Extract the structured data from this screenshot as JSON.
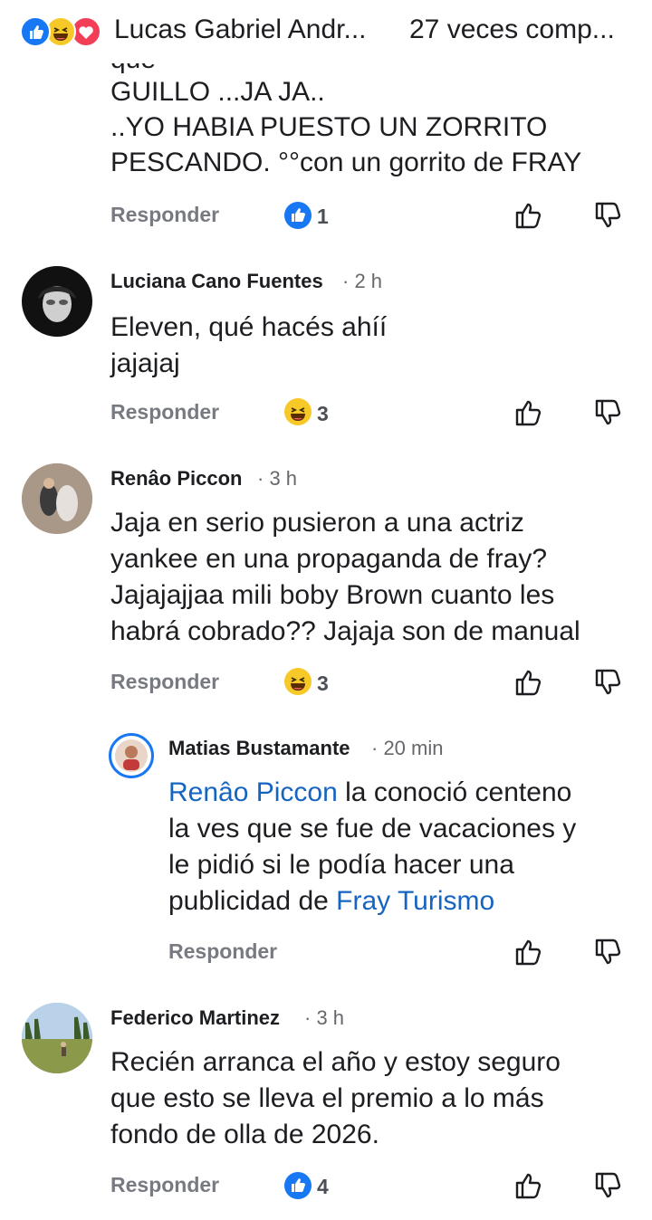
{
  "header": {
    "commenter_name": "Lucas Gabriel Andr...",
    "shares": "27 veces comp..."
  },
  "first_comment": {
    "partial_line": "que",
    "lines": [
      "GUILLO ...JA JA..",
      "..YO HABIA PUESTO UN ZORRITO",
      "PESCANDO. °°con  un gorrito de FRAY"
    ],
    "reply_label": "Responder",
    "reaction": "like-icon",
    "reaction_count": "1"
  },
  "comments": [
    {
      "author": "Luciana Cano Fuentes",
      "time": "· 2 h",
      "lines": [
        "Eleven, qué hacés ahíí",
        "jajajaj"
      ],
      "reply_label": "Responder",
      "reaction": "haha-emoji-icon",
      "reaction_count": "3"
    },
    {
      "author": "Renâo Piccon",
      "time": "· 3 h",
      "lines": [
        "Jaja en serio pusieron a una actriz",
        "yankee en una propaganda de fray?",
        "Jajajajjaa mili boby Brown cuanto les",
        "habrá cobrado?? Jajaja son de manual"
      ],
      "reply_label": "Responder",
      "reaction": "haha-emoji-icon",
      "reaction_count": "3"
    },
    {
      "author": "Matias Bustamante",
      "time": "· 20 min",
      "mention": "Renâo Piccon",
      "line1_rest": " la conoció centeno",
      "line2": "la ves que se fue de vacaciones y",
      "line3": "le pidió si le podía hacer una",
      "line4_start": "publicidad de ",
      "mention2": "Fray Turismo",
      "reply_label": "Responder"
    },
    {
      "author": "Federico Martinez",
      "time": "· 3 h",
      "lines": [
        "Recién arranca el año y estoy seguro",
        "que esto se lleva el premio a lo más",
        "fondo de olla de 2026."
      ],
      "reply_label": "Responder",
      "reaction": "like-icon",
      "reaction_count": "4"
    }
  ],
  "colors": {
    "like_blue": "#1877f2",
    "mention_blue": "#1565c0",
    "haha_yellow": "#f7c928",
    "love_red": "#f33e58"
  }
}
